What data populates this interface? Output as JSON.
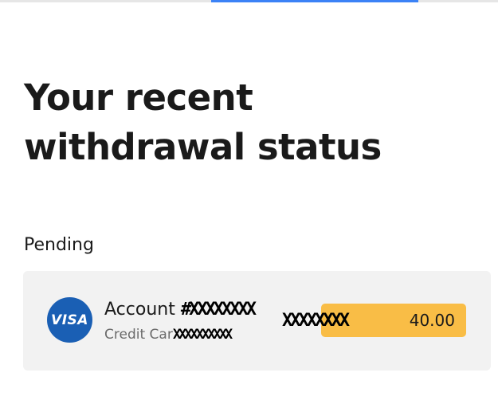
{
  "page": {
    "title": "Your recent withdrawal status"
  },
  "section": {
    "label": "Pending"
  },
  "withdrawal": {
    "card_brand": "VISA",
    "account_prefix": "Account",
    "account_masked": "#XXXXXXXX",
    "method_label": "Credit Car",
    "method_masked": "XXXXXXXXXX",
    "amount_masked": "XXXXXXXX",
    "amount_suffix": "40.00",
    "status_color": "#f9bd46"
  },
  "colors": {
    "visa_brand": "#1a5fb4",
    "card_background": "#f2f2f2",
    "accent_bar": "#3b82f6"
  }
}
